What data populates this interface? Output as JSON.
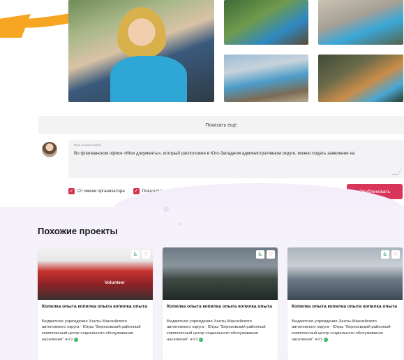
{
  "gallery": {
    "show_more_label": "Показать еще"
  },
  "comment": {
    "label": "Ваш комментарий",
    "text": "Во флагманском офисе «Мои документы», который расположен в Юго-Западном административном округе, можно подать заявление на"
  },
  "options": {
    "as_organizer": "От имени организатора",
    "only_employees": "Показывать только сотрудникам",
    "publish_label": "Опубликовать"
  },
  "similar": {
    "title": "Похожие проекты",
    "cards": [
      {
        "title": "Копилка опыта копилка опыта копилка опыта",
        "desc": "Бюджетное учреждение Ханты-Мансийского автономного округа - Югры \"Березовский районный комплексный центр социального обслуживания населения\"",
        "rating": "4.9",
        "img_text": "Volunteer"
      },
      {
        "title": "Копилка опыта копилка опыта копилка опыта",
        "desc": "Бюджетное учреждение Ханты-Мансийского автономного округа - Югры \"Березовский районный комплексный центр социального обслуживания населения\"",
        "rating": "4.9"
      },
      {
        "title": "Копилка опыта копилка опыта копилка опыта",
        "desc": "Бюджетное учреждение Ханты-Мансийского автономного округа - Югры \"Березовский районный комплексный центр социального обслуживания населения\"",
        "rating": "4.9"
      }
    ]
  },
  "colors": {
    "accent": "#d7355a",
    "swoosh": "#f6a623",
    "verified": "#2fb565"
  },
  "icons": {
    "accessibility": "wheelchair-icon",
    "favorite": "heart-icon",
    "attach": "paperclip-icon",
    "star": "star-icon",
    "verified": "check-circle-icon"
  }
}
